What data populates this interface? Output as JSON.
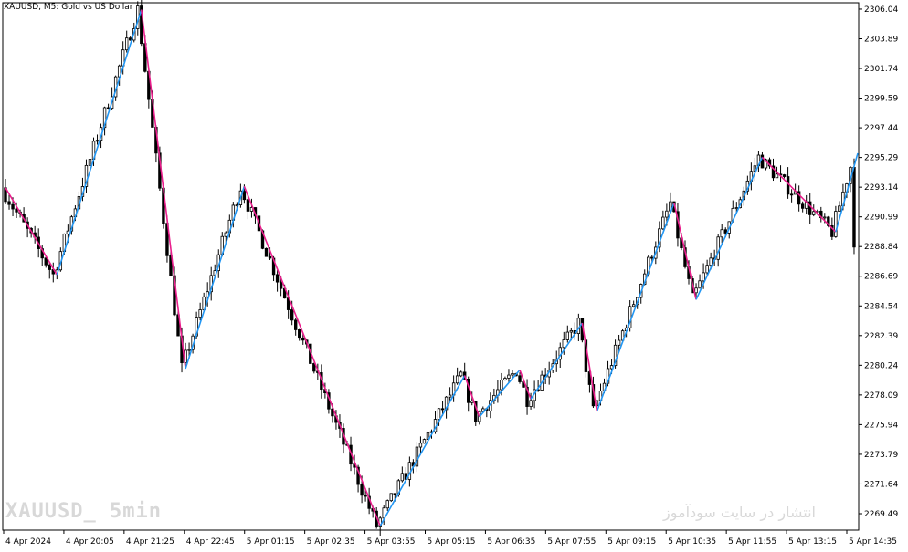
{
  "header": {
    "symbol_text": "XAUUSD, M5:  Gold vs US Dollar"
  },
  "watermark": {
    "left": "XAUUSD_ 5min",
    "right": "انتشار در سایت سودآموز"
  },
  "colors": {
    "up_leg": "#2196f3",
    "down_leg": "#e91e8c",
    "candle": "#000000",
    "background": "#ffffff"
  },
  "chart_data": {
    "type": "candlestick",
    "title": "XAUUSD, M5:  Gold vs US Dollar",
    "ylim": [
      2268.3,
      2306.5
    ],
    "y_ticks": [
      "2306.04",
      "2303.89",
      "2301.74",
      "2299.59",
      "2297.44",
      "2295.29",
      "2293.14",
      "2290.99",
      "2288.84",
      "2286.69",
      "2284.54",
      "2282.39",
      "2280.24",
      "2278.09",
      "2275.94",
      "2273.79",
      "2271.64",
      "2269.49"
    ],
    "x_ticks": [
      "4 Apr 2024",
      "4 Apr 20:05",
      "4 Apr 21:25",
      "4 Apr 22:45",
      "5 Apr 01:15",
      "5 Apr 02:35",
      "5 Apr 03:55",
      "5 Apr 05:15",
      "5 Apr 06:35",
      "5 Apr 07:55",
      "5 Apr 09:15",
      "5 Apr 10:35",
      "5 Apr 11:55",
      "5 Apr 13:15",
      "5 Apr 14:35"
    ],
    "bar_count": 232,
    "zigzag": [
      [
        0,
        2293.1
      ],
      [
        14,
        2286.8
      ],
      [
        37,
        2306.0
      ],
      [
        49,
        2280.0
      ],
      [
        65,
        2293.2
      ],
      [
        102,
        2268.6
      ],
      [
        125,
        2279.5
      ],
      [
        129,
        2276.5
      ],
      [
        140,
        2279.9
      ],
      [
        143,
        2277.8
      ],
      [
        157,
        2283.3
      ],
      [
        161,
        2276.9
      ],
      [
        182,
        2292.0
      ],
      [
        188,
        2285.0
      ],
      [
        206,
        2295.3
      ],
      [
        226,
        2289.9
      ],
      [
        232,
        2295.6
      ]
    ],
    "last_price": 2288.8
  }
}
